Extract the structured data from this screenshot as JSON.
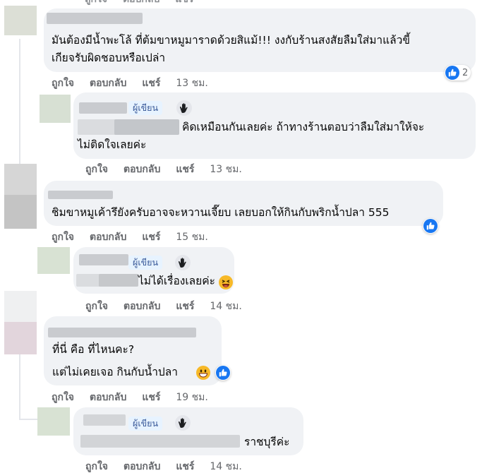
{
  "actions": {
    "like": "ถูกใจ",
    "reply": "ตอบกลับ",
    "share": "แชร์"
  },
  "author_badge": "ผู้เขียน",
  "comments": [
    {
      "lines": [
        "มันต้องมีน้ำพะโล้ ที่ต้มขาหมูมาราดด้วยสิแม้!!! งงกับร้านสงสัยลืมใส่มาแล้วขี้",
        "เกียจรับผิดชอบหรือเปล่า"
      ],
      "time": "13 ชม.",
      "reactions": 2
    },
    {
      "lines": [
        "คิดเหมือนกันเลยค่ะ ถ้าทางร้านตอบว่าลืมใส่มาให้จะ",
        "ไม่ติดใจเลยค่ะ"
      ],
      "time": "13 ชม."
    },
    {
      "lines": [
        "ชิมขาหมูเค้ารึยังครับอาจจะหวานเจี๊ยบ เลยบอกให้กินกับพริกน้ำปลา 555"
      ],
      "time": "15 ชม."
    },
    {
      "lines": [
        "ไม่ได้เรื่องเลยค่ะ"
      ],
      "time": "14 ชม."
    },
    {
      "lines": [
        "ที่นี่ คือ ที่ไหนคะ?",
        "แต่ไม่เคยเจอ กินกับน้ำปลา"
      ],
      "time": "19 ชม."
    },
    {
      "lines": [
        "ราชบุรีค่ะ"
      ],
      "time": "14 ชม."
    }
  ],
  "icons": {
    "like": "like-icon",
    "wave": "wave-hand-icon",
    "laugh": "laughing-emoji-icon",
    "grin": "grinning-emoji-icon"
  },
  "colors": {
    "like_blue": "#1877f2",
    "bubble": "#f0f2f5",
    "meta_gray": "#65676b",
    "badge_text": "#385898"
  }
}
